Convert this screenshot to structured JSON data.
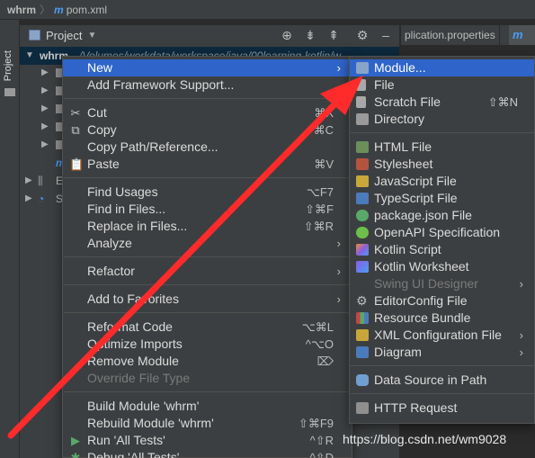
{
  "breadcrumb": {
    "project": "whrm",
    "file": "pom.xml"
  },
  "sidebar": {
    "tool_window_label": "Project"
  },
  "project_panel": {
    "title": "Project",
    "root_name": "whrm",
    "root_path": "/Volumes/workdata/workspace/java/00learning-kotlin/w..."
  },
  "tree_rows_partial": [
    "E",
    "S"
  ],
  "editor_tab": "plication.properties",
  "context_menu": {
    "items": [
      {
        "label": "New",
        "submenu": true,
        "selected": true
      },
      {
        "label": "Add Framework Support..."
      },
      {
        "label": "Cut",
        "icon": "cut-icon",
        "shortcut": "⌘X"
      },
      {
        "label": "Copy",
        "icon": "copy-icon",
        "shortcut": "⌘C"
      },
      {
        "label": "Copy Path/Reference..."
      },
      {
        "label": "Paste",
        "icon": "paste-icon",
        "shortcut": "⌘V"
      },
      {
        "label": "Find Usages",
        "shortcut": "⌥F7"
      },
      {
        "label": "Find in Files...",
        "shortcut": "⇧⌘F"
      },
      {
        "label": "Replace in Files...",
        "shortcut": "⇧⌘R"
      },
      {
        "label": "Analyze",
        "submenu": true
      },
      {
        "label": "Refactor",
        "submenu": true
      },
      {
        "label": "Add to Favorites",
        "submenu": true
      },
      {
        "label": "Reformat Code",
        "shortcut": "⌥⌘L"
      },
      {
        "label": "Optimize Imports",
        "shortcut": "^⌥O"
      },
      {
        "label": "Remove Module",
        "shortcut": "⌦"
      },
      {
        "label": "Override File Type",
        "disabled": true
      },
      {
        "label": "Build Module 'whrm'"
      },
      {
        "label": "Rebuild Module 'whrm'",
        "shortcut": "⇧⌘F9"
      },
      {
        "label": "Run 'All Tests'",
        "icon": "run-icon",
        "shortcut": "^⇧R"
      },
      {
        "label": "Debug 'All Tests'",
        "icon": "debug-icon",
        "shortcut": "^⇧D"
      }
    ]
  },
  "new_submenu": {
    "items": [
      {
        "label": "Module...",
        "icon": "module-icon",
        "selected": true
      },
      {
        "label": "File",
        "icon": "file-icon"
      },
      {
        "label": "Scratch File",
        "icon": "scratch-file-icon",
        "shortcut": "⇧⌘N"
      },
      {
        "label": "Directory",
        "icon": "directory-icon"
      },
      {
        "label": "HTML File",
        "icon": "html-file-icon"
      },
      {
        "label": "Stylesheet",
        "icon": "css-icon"
      },
      {
        "label": "JavaScript File",
        "icon": "js-icon"
      },
      {
        "label": "TypeScript File",
        "icon": "ts-icon"
      },
      {
        "label": "package.json File",
        "icon": "npm-icon"
      },
      {
        "label": "OpenAPI Specification",
        "icon": "openapi-icon"
      },
      {
        "label": "Kotlin Script",
        "icon": "kotlin-icon"
      },
      {
        "label": "Kotlin Worksheet",
        "icon": "kotlin-worksheet-icon"
      },
      {
        "label": "Swing UI Designer",
        "submenu": true,
        "disabled": true
      },
      {
        "label": "EditorConfig File",
        "icon": "gear-icon"
      },
      {
        "label": "Resource Bundle",
        "icon": "resource-bundle-icon"
      },
      {
        "label": "XML Configuration File",
        "icon": "xml-icon",
        "submenu": true
      },
      {
        "label": "Diagram",
        "icon": "diagram-icon",
        "submenu": true
      },
      {
        "label": "Data Source in Path",
        "icon": "database-icon"
      },
      {
        "label": "HTTP Request",
        "icon": "api-icon"
      }
    ]
  },
  "watermark": "https://blog.csdn.net/wm9028",
  "colors": {
    "selection": "#2f65ca",
    "menu_bg": "#3c3f41",
    "arrow": "#ff2a2a"
  }
}
